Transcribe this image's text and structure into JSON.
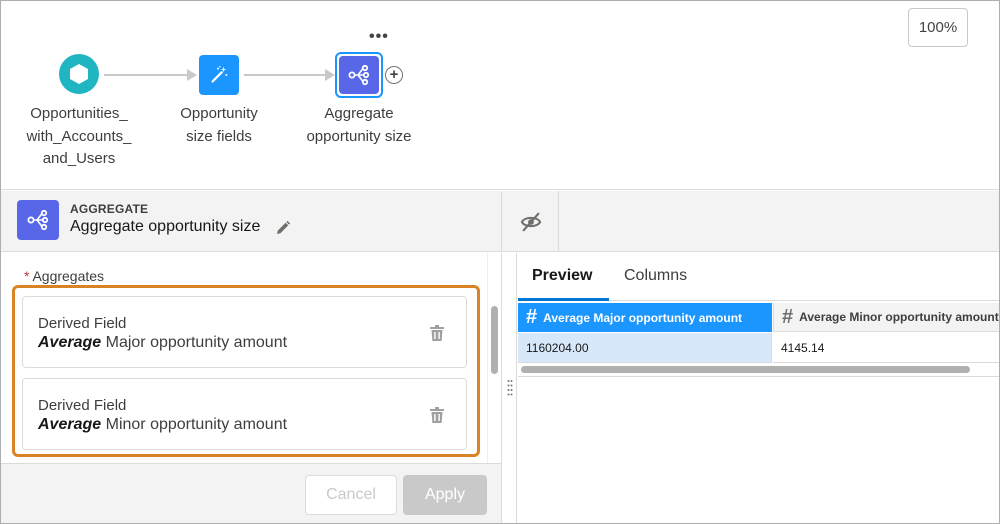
{
  "canvas": {
    "zoom_label": "100%",
    "more_label": "•••",
    "add_label": "+",
    "nodes": [
      {
        "label_lines": [
          "Opportunities_",
          "with_Accounts_",
          "and_Users"
        ],
        "icon": "hexagon-icon"
      },
      {
        "label_lines": [
          "Opportunity",
          "size fields"
        ],
        "icon": "magic-wand-icon"
      },
      {
        "label_lines": [
          "Aggregate",
          "opportunity size"
        ],
        "icon": "aggregate-icon"
      }
    ]
  },
  "header": {
    "type_label": "AGGREGATE",
    "title": "Aggregate opportunity size",
    "edit_icon": "pencil-icon",
    "visibility_icon": "eye-off-icon"
  },
  "aggregates": {
    "required_mark": "*",
    "label": "Aggregates",
    "items": [
      {
        "title": "Derived Field",
        "function": "Average",
        "field": "Major opportunity amount"
      },
      {
        "title": "Derived Field",
        "function": "Average",
        "field": "Minor opportunity amount"
      }
    ]
  },
  "footer": {
    "cancel_label": "Cancel",
    "apply_label": "Apply"
  },
  "preview": {
    "tabs": [
      "Preview",
      "Columns"
    ],
    "active_tab": "Preview",
    "columns": [
      {
        "type_symbol": "#",
        "name": "Average Major opportunity amount"
      },
      {
        "type_symbol": "#",
        "name": "Average Minor opportunity amount"
      }
    ],
    "rows": [
      [
        "1160204.00",
        "4145.14"
      ]
    ]
  },
  "colors": {
    "highlight": "#d98324",
    "accent": "#1b96ff",
    "aggregate_icon": "#5867e8",
    "source_icon": "#1fb6c2"
  }
}
